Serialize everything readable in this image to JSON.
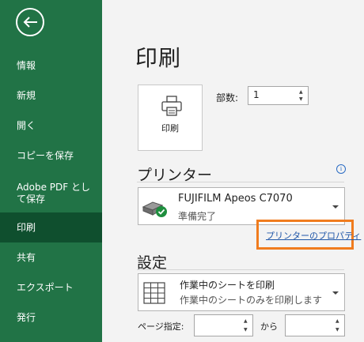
{
  "sidebar": {
    "items": [
      {
        "label": "情報",
        "active": false
      },
      {
        "label": "新規",
        "active": false
      },
      {
        "label": "開く",
        "active": false
      },
      {
        "label": "コピーを保存",
        "active": false
      },
      {
        "label": "Adobe PDF として保存",
        "active": false
      },
      {
        "label": "印刷",
        "active": true
      },
      {
        "label": "共有",
        "active": false
      },
      {
        "label": "エクスポート",
        "active": false
      },
      {
        "label": "発行",
        "active": false
      }
    ],
    "back_icon": "back-arrow-icon"
  },
  "main": {
    "title": "印刷",
    "print_button_label": "印刷",
    "copies": {
      "label": "部数:",
      "value": "1"
    },
    "printer_section": {
      "title": "プリンター",
      "printer_name": "FUJIFILM Apeos C7070",
      "printer_status": "準備完了",
      "properties_link": "プリンターのプロパティ"
    },
    "settings_section": {
      "title": "設定",
      "print_what_title": "作業中のシートを印刷",
      "print_what_desc": "作業中のシートのみを印刷します",
      "pages_label": "ページ指定:",
      "pages_from": "",
      "pages_to_label": "から",
      "pages_to": ""
    }
  },
  "colors": {
    "sidebar_bg": "#217346",
    "sidebar_active": "#0f4f2e",
    "highlight": "#f07c1e",
    "link": "#1f56a8"
  }
}
